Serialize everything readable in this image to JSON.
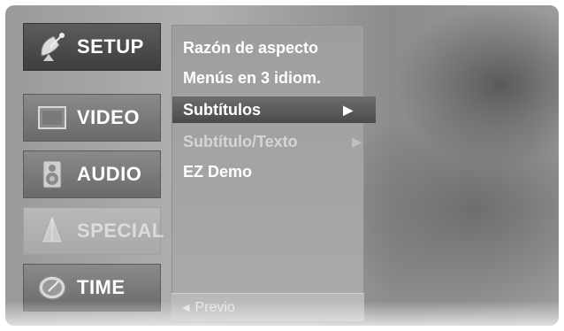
{
  "categories": [
    {
      "label": "SETUP",
      "icon": "satellite-dish-icon",
      "state": "active"
    },
    {
      "label": "VIDEO",
      "icon": "screen-icon",
      "state": "normal"
    },
    {
      "label": "AUDIO",
      "icon": "speaker-icon",
      "state": "normal"
    },
    {
      "label": "SPECIAL",
      "icon": "special-icon",
      "state": "dim"
    },
    {
      "label": "TIME",
      "icon": "clock-icon",
      "state": "normal"
    }
  ],
  "menu_items": [
    {
      "label": "Razón de aspecto"
    },
    {
      "label": "Menús en 3 idiom."
    },
    {
      "label": "Subtítulos",
      "arrow": "▶",
      "selected": true
    },
    {
      "label": "Subtítulo/Texto",
      "arrow": "▶",
      "faded": true
    },
    {
      "label": "EZ Demo"
    }
  ],
  "footer": {
    "previous_label": "Previo",
    "previous_arrow": "◀"
  },
  "colors": {
    "highlight": "#4a4a4a",
    "panel": "#a5a5a5",
    "text": "#ffffff"
  }
}
